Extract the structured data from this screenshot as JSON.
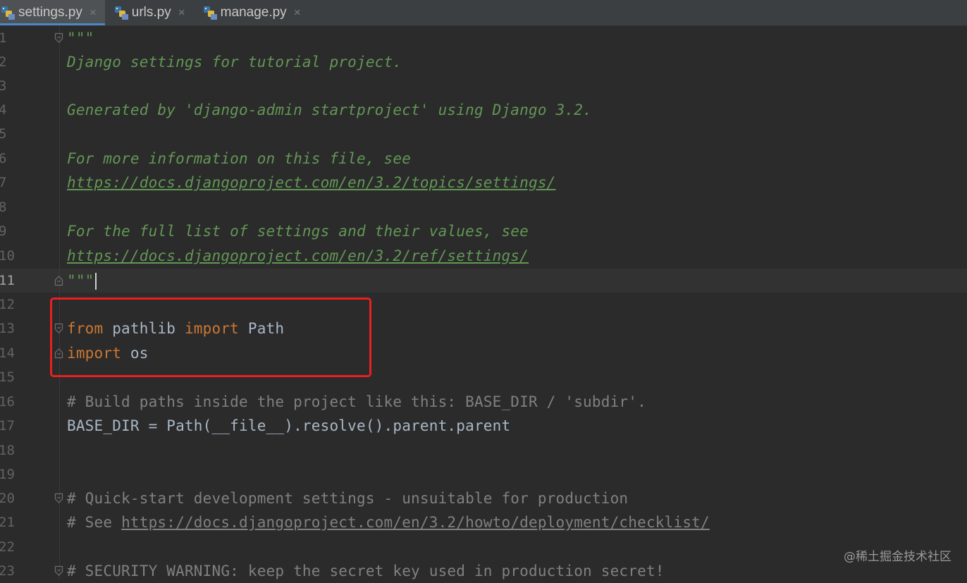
{
  "tabs": [
    {
      "label": "settings.py",
      "close": "×",
      "active": true
    },
    {
      "label": "urls.py",
      "close": "×",
      "active": false
    },
    {
      "label": "manage.py",
      "close": "×",
      "active": false
    }
  ],
  "line_numbers": [
    "1",
    "2",
    "3",
    "4",
    "5",
    "6",
    "7",
    "8",
    "9",
    "10",
    "11",
    "12",
    "13",
    "14",
    "15",
    "16",
    "17",
    "18",
    "19",
    "20",
    "21",
    "22",
    "23"
  ],
  "code": {
    "l1": "\"\"\"",
    "l2": "Django settings for tutorial project.",
    "l4": "Generated by 'django-admin startproject' using Django 3.2.",
    "l6": "For more information on this file, see",
    "l7": "https://docs.djangoproject.com/en/3.2/topics/settings/",
    "l9": "For the full list of settings and their values, see",
    "l10": "https://docs.djangoproject.com/en/3.2/ref/settings/",
    "l11": "\"\"\"",
    "l13_kw1": "from",
    "l13_mod": " pathlib ",
    "l13_kw2": "import",
    "l13_name": " Path",
    "l14_kw": "import",
    "l14_name": " os",
    "l16": "# Build paths inside the project like this: BASE_DIR / 'subdir'.",
    "l17": "BASE_DIR = Path(__file__).resolve().parent.parent",
    "l20": "# Quick-start development settings - unsuitable for production",
    "l21_prefix": "# See ",
    "l21_link": "https://docs.djangoproject.com/en/3.2/howto/deployment/checklist/",
    "l23": "# SECURITY WARNING: keep the secret key used in production secret!"
  },
  "watermark": "@稀土掘金技术社区",
  "colors": {
    "background": "#2b2b2b",
    "docstring": "#629755",
    "keyword": "#cc7832",
    "comment": "#808080",
    "text": "#a9b7c6",
    "highlight_box": "#e8201f"
  }
}
